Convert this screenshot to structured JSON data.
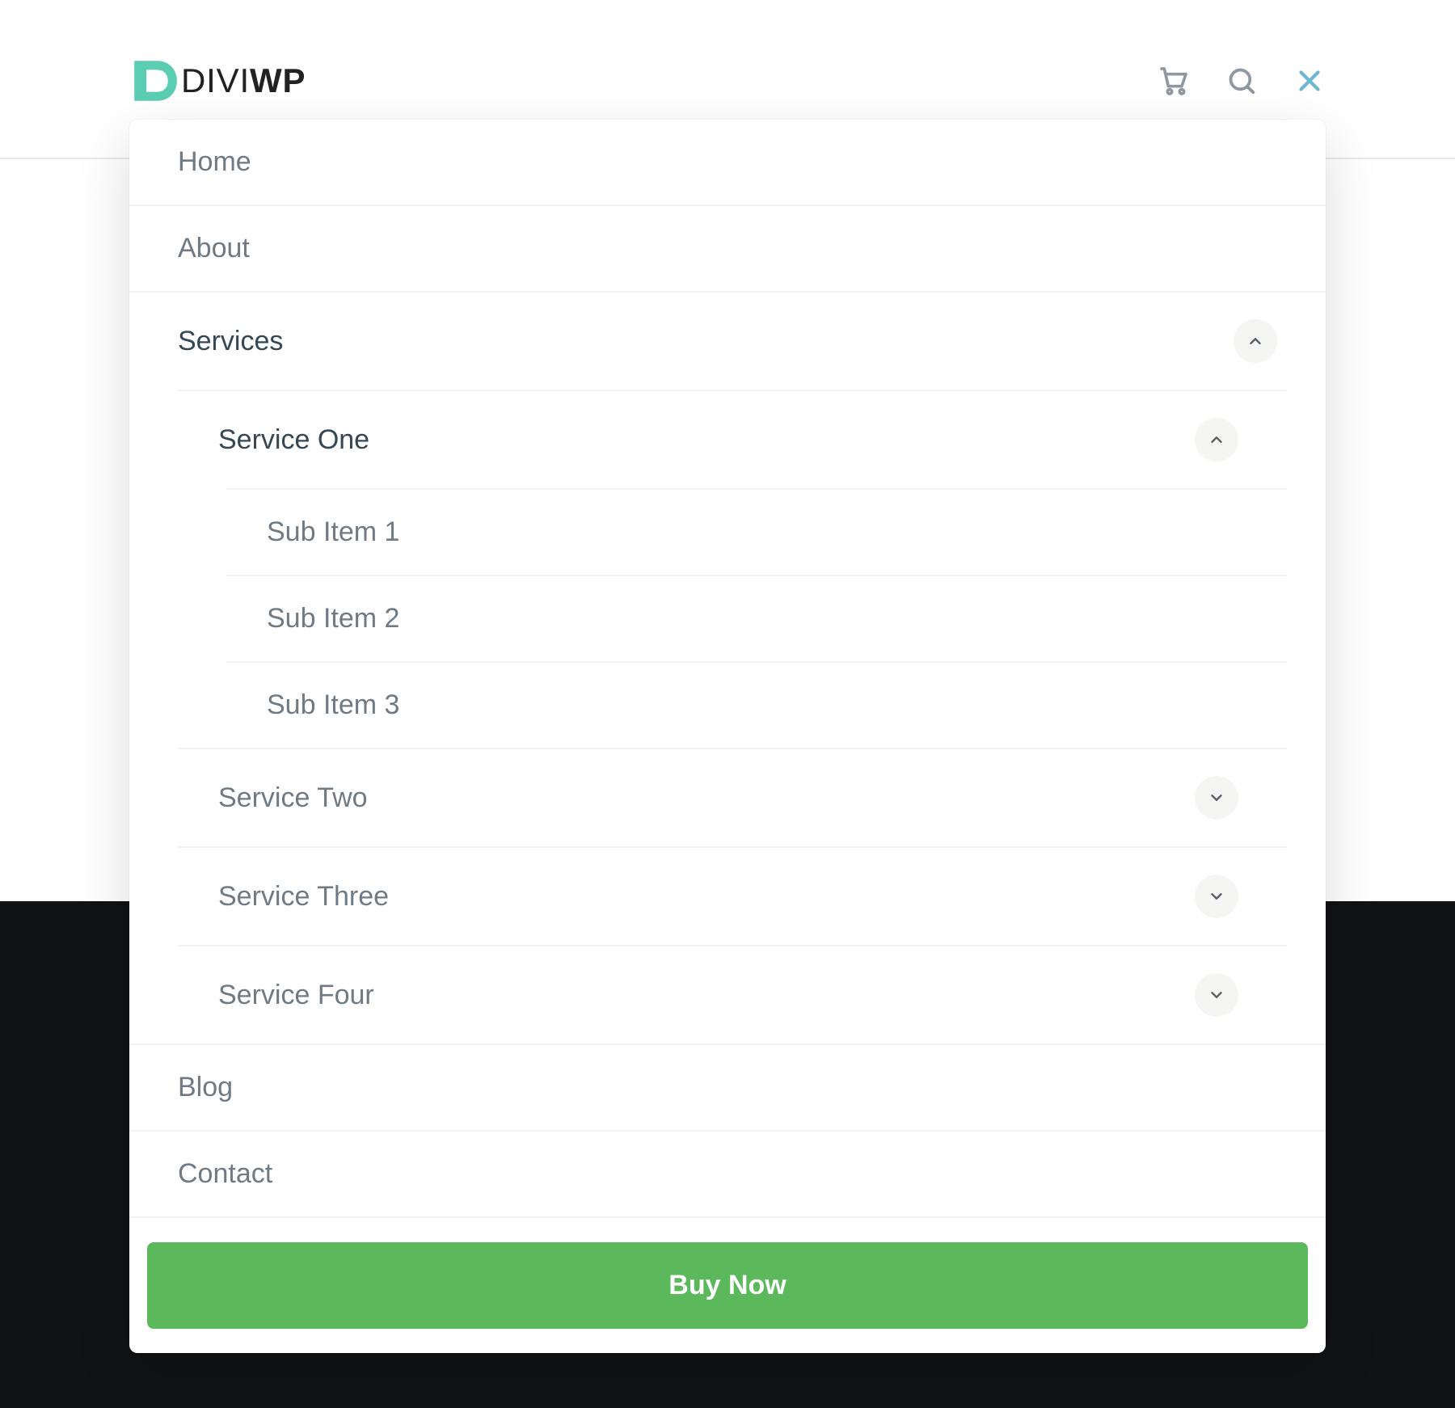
{
  "brand": {
    "part1": "DIVI",
    "part2": "WP"
  },
  "colors": {
    "accent_teal": "#5bcdb3",
    "cta_green": "#5bb85b",
    "close_blue": "#6eb8cf"
  },
  "nav": {
    "items": [
      {
        "label": "Home",
        "expandable": false,
        "expanded": false,
        "active": false
      },
      {
        "label": "About",
        "expandable": false,
        "expanded": false,
        "active": false
      },
      {
        "label": "Services",
        "expandable": true,
        "expanded": true,
        "active": true,
        "children": [
          {
            "label": "Service One",
            "expandable": true,
            "expanded": true,
            "active": true,
            "children": [
              {
                "label": "Sub Item 1",
                "expandable": false
              },
              {
                "label": "Sub Item 2",
                "expandable": false
              },
              {
                "label": "Sub Item 3",
                "expandable": false
              }
            ]
          },
          {
            "label": "Service Two",
            "expandable": true,
            "expanded": false,
            "active": false
          },
          {
            "label": "Service Three",
            "expandable": true,
            "expanded": false,
            "active": false
          },
          {
            "label": "Service Four",
            "expandable": true,
            "expanded": false,
            "active": false
          }
        ]
      },
      {
        "label": "Blog",
        "expandable": false,
        "expanded": false,
        "active": false
      },
      {
        "label": "Contact",
        "expandable": false,
        "expanded": false,
        "active": false
      }
    ]
  },
  "cta": {
    "label": "Buy Now"
  }
}
